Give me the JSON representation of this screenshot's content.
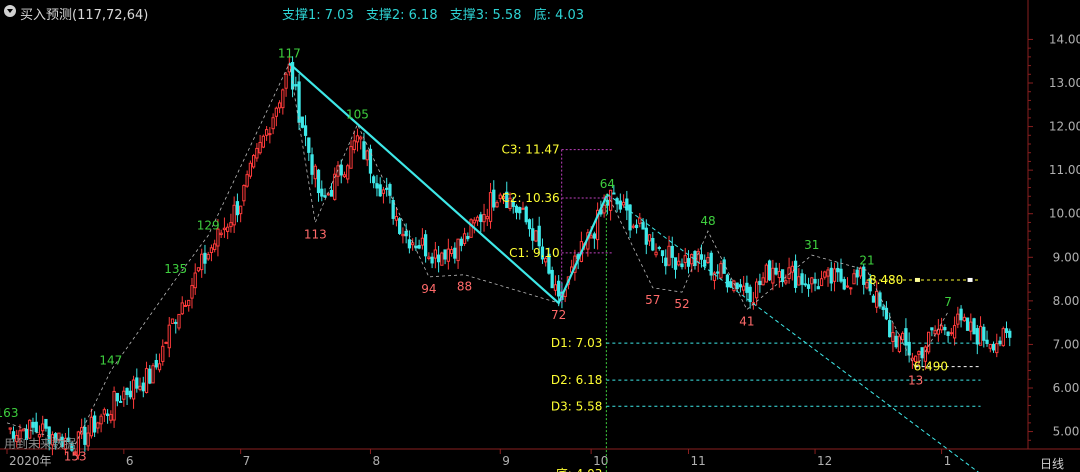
{
  "header": {
    "title": "买入预测(117,72,64)",
    "support1": "支撑1: 7.03",
    "support2": "支撑2: 6.18",
    "support3": "支撑3: 5.58",
    "bottom": "底: 4.03"
  },
  "note": "用到未来数据",
  "period_button": "日线",
  "colors": {
    "up": "#ff3b3b",
    "down": "#3ee8e8",
    "trend": "#3ee8e8",
    "peak_label": "#3ecf3e",
    "trough_label": "#ff6a6a",
    "level_label": "#ffff33",
    "axis_text": "#b0b0b0",
    "grid": "#8a1f1f",
    "magenta": "#c040c0",
    "green_line": "#3ecf3e"
  },
  "chart_data": {
    "type": "candlestick",
    "y_axis": {
      "ylim": [
        4.6,
        14.4
      ],
      "ticks": [
        "14.00",
        "13.00",
        "12.00",
        "11.00",
        "10.00",
        "9.00",
        "8.00",
        "7.00",
        "6.00",
        "5.00"
      ],
      "tick_values": [
        14,
        13,
        12,
        11,
        10,
        9,
        8,
        7,
        6,
        5
      ]
    },
    "x_axis": {
      "labels": [
        "2020年",
        "6",
        "7",
        "8",
        "9",
        "10",
        "11",
        "12",
        "1"
      ],
      "positions": [
        0,
        36,
        72,
        112,
        152,
        180,
        210,
        249,
        288
      ]
    },
    "n_bars": 310,
    "anchors": [
      [
        0,
        5.05
      ],
      [
        10,
        5.05
      ],
      [
        20,
        4.75
      ],
      [
        22,
        4.75
      ],
      [
        36,
        5.9
      ],
      [
        45,
        6.3
      ],
      [
        52,
        7.7
      ],
      [
        62,
        9.1
      ],
      [
        72,
        10.3
      ],
      [
        87,
        13.3
      ],
      [
        97,
        10.2
      ],
      [
        108,
        11.7
      ],
      [
        123,
        9.5
      ],
      [
        132,
        9.1
      ],
      [
        140,
        9.3
      ],
      [
        152,
        10.6
      ],
      [
        162,
        9.6
      ],
      [
        170,
        7.9
      ],
      [
        175,
        8.8
      ],
      [
        186,
        10.4
      ],
      [
        194,
        9.7
      ],
      [
        204,
        9.0
      ],
      [
        214,
        8.9
      ],
      [
        230,
        8.2
      ],
      [
        236,
        8.8
      ],
      [
        248,
        8.4
      ],
      [
        256,
        8.5
      ],
      [
        265,
        8.5
      ],
      [
        272,
        7.3
      ],
      [
        280,
        6.7
      ],
      [
        286,
        7.3
      ],
      [
        292,
        7.5
      ],
      [
        300,
        7.2
      ],
      [
        305,
        7.1
      ]
    ],
    "peaks": [
      {
        "bar": 87,
        "label": "117",
        "price": 13.45
      },
      {
        "bar": 108,
        "label": "105",
        "price": 12.05
      },
      {
        "bar": 62,
        "label": "129",
        "price": 9.5
      },
      {
        "bar": 52,
        "label": "135",
        "price": 8.5
      },
      {
        "bar": 32,
        "label": "147",
        "price": 6.4
      },
      {
        "bar": 0,
        "label": "163",
        "price": 5.2
      },
      {
        "bar": 185,
        "label": "64",
        "price": 10.45
      },
      {
        "bar": 216,
        "label": "48",
        "price": 9.6
      },
      {
        "bar": 248,
        "label": "31",
        "price": 9.05
      },
      {
        "bar": 265,
        "label": "21",
        "price": 8.7
      },
      {
        "bar": 290,
        "label": "7",
        "price": 7.75
      }
    ],
    "troughs": [
      {
        "bar": 21,
        "label": "153",
        "price": 4.7
      },
      {
        "bar": 95,
        "label": "113",
        "price": 9.8
      },
      {
        "bar": 130,
        "label": "94",
        "price": 8.55
      },
      {
        "bar": 141,
        "label": "88",
        "price": 8.6
      },
      {
        "bar": 170,
        "label": "72",
        "price": 7.95
      },
      {
        "bar": 199,
        "label": "57",
        "price": 8.3
      },
      {
        "bar": 208,
        "label": "52",
        "price": 8.2
      },
      {
        "bar": 228,
        "label": "41",
        "price": 7.8
      },
      {
        "bar": 280,
        "label": "13",
        "price": 6.45
      }
    ],
    "pattern_points": [
      [
        87,
        13.45
      ],
      [
        170,
        7.95
      ],
      [
        185,
        10.45
      ]
    ],
    "c_levels": [
      {
        "label": "C3: 11.47",
        "value": 11.47
      },
      {
        "label": "C2: 10.36",
        "value": 10.36
      },
      {
        "label": "C1: 9.10",
        "value": 9.1
      }
    ],
    "d_levels": [
      {
        "label": "D1: 7.03",
        "value": 7.03
      },
      {
        "label": "D2: 6.18",
        "value": 6.18
      },
      {
        "label": "D3: 5.58",
        "value": 5.58
      },
      {
        "label": "底: 4.03",
        "value": 4.03
      }
    ],
    "marker_levels": [
      {
        "label": "8.480",
        "value": 8.48
      },
      {
        "label": "6.490",
        "value": 6.49
      }
    ],
    "projection_end": [
      300,
      4.03
    ]
  }
}
